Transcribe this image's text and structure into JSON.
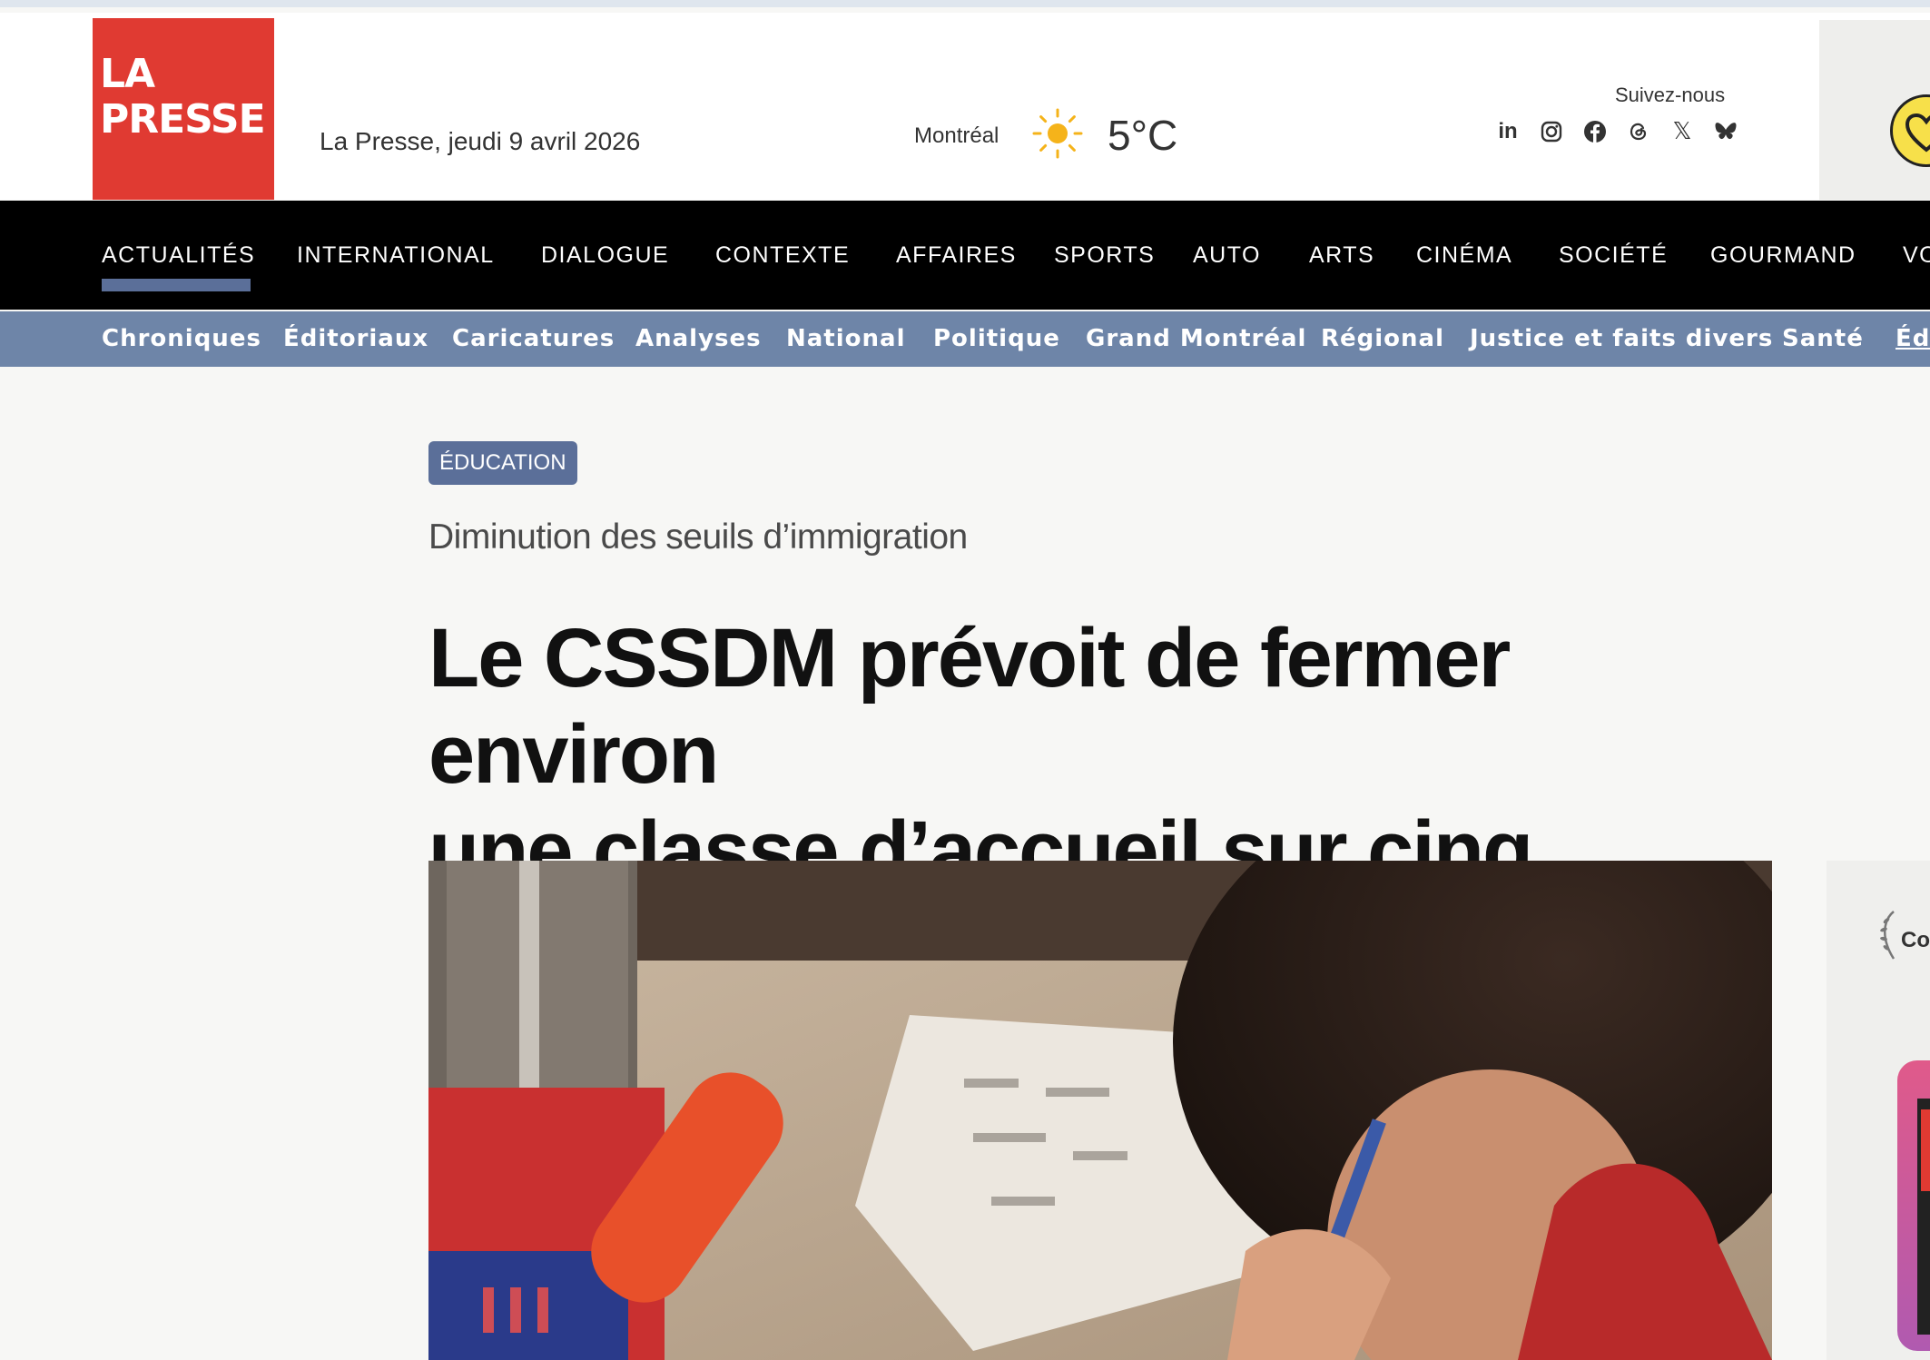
{
  "header": {
    "logo_line1": "LA",
    "logo_line2": "PRESSE",
    "date": "La Presse, jeudi 9 avril 2026",
    "weather": {
      "city": "Montréal",
      "icon": "sun-icon",
      "temperature": "5°C"
    },
    "follow_label": "Suivez-nous",
    "socials": [
      {
        "name": "linkedin-icon",
        "glyph": "in"
      },
      {
        "name": "instagram-icon"
      },
      {
        "name": "facebook-icon"
      },
      {
        "name": "threads-icon"
      },
      {
        "name": "x-icon",
        "glyph": "𝕏"
      },
      {
        "name": "bluesky-icon"
      }
    ]
  },
  "main_nav": {
    "items": [
      "ACTUALITÉS",
      "INTERNATIONAL",
      "DIALOGUE",
      "CONTEXTE",
      "AFFAIRES",
      "SPORTS",
      "AUTO",
      "ARTS",
      "CINÉMA",
      "SOCIÉTÉ",
      "GOURMAND",
      "VO"
    ],
    "active": "ACTUALITÉS"
  },
  "sub_nav": {
    "items": [
      "Chroniques",
      "Éditoriaux",
      "Caricatures",
      "Analyses",
      "National",
      "Politique",
      "Grand Montréal",
      "Régional",
      "Justice et faits divers",
      "Santé",
      "Édu"
    ]
  },
  "article": {
    "tag": "ÉDUCATION",
    "kicker": "Diminution des seuils d’immigration",
    "headline_line1": "Le CSSDM prévoit de fermer environ",
    "headline_line2": "une classe d’accueil sur cinq"
  },
  "sidebar": {
    "partial_text": "Co"
  },
  "colors": {
    "brand_red": "#e03a32",
    "nav_black": "#000000",
    "subnav_blue": "#6e85a8",
    "tag_blue": "#5b6f99",
    "accent_yellow": "#f7e04a"
  }
}
